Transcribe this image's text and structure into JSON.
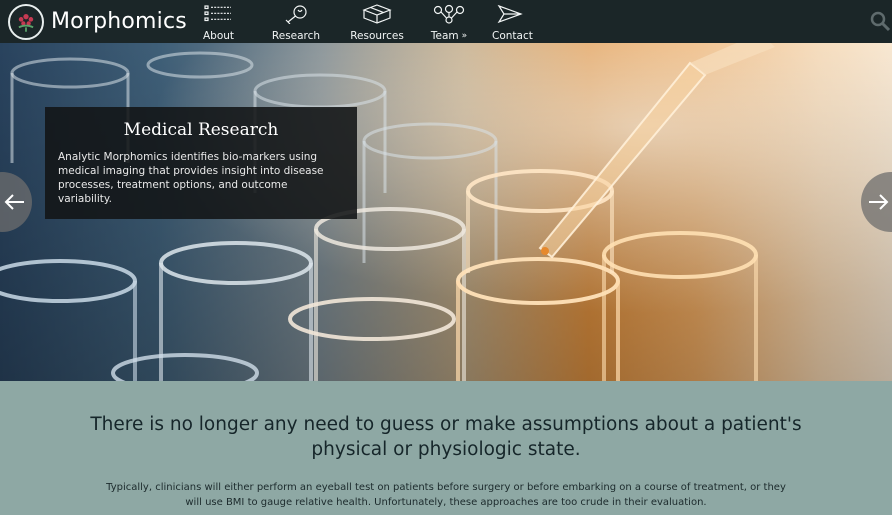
{
  "brand": {
    "name": "Morphomics"
  },
  "nav": {
    "items": [
      {
        "label": "About",
        "icon": "list-icon",
        "has_dropdown": false
      },
      {
        "label": "Research",
        "icon": "lightbulb-icon",
        "has_dropdown": true
      },
      {
        "label": "Resources",
        "icon": "box-icon",
        "has_dropdown": true
      },
      {
        "label": "Team",
        "icon": "network-icon",
        "has_dropdown": true
      },
      {
        "label": "Contact",
        "icon": "paper-plane-icon",
        "has_dropdown": false
      }
    ],
    "chevron": "»"
  },
  "hero": {
    "caption_title": "Medical Research",
    "caption_body": "Analytic Morphomics identifies bio-markers using medical imaging that provides insight into disease processes, treatment options, and outcome variability."
  },
  "content": {
    "headline": "There is no longer any need to guess or make assumptions about a patient's physical or physiologic state.",
    "body": "Typically, clinicians will either perform an eyeball test on patients before surgery or before embarking on a course of treatment, or they will use BMI to gauge relative health. Unfortunately, these approaches are too crude in their evaluation."
  },
  "colors": {
    "nav_bg": "#1b2628",
    "content_bg": "#8ea8a4",
    "caption_bg": "#121416",
    "text_dark": "#16262a"
  }
}
